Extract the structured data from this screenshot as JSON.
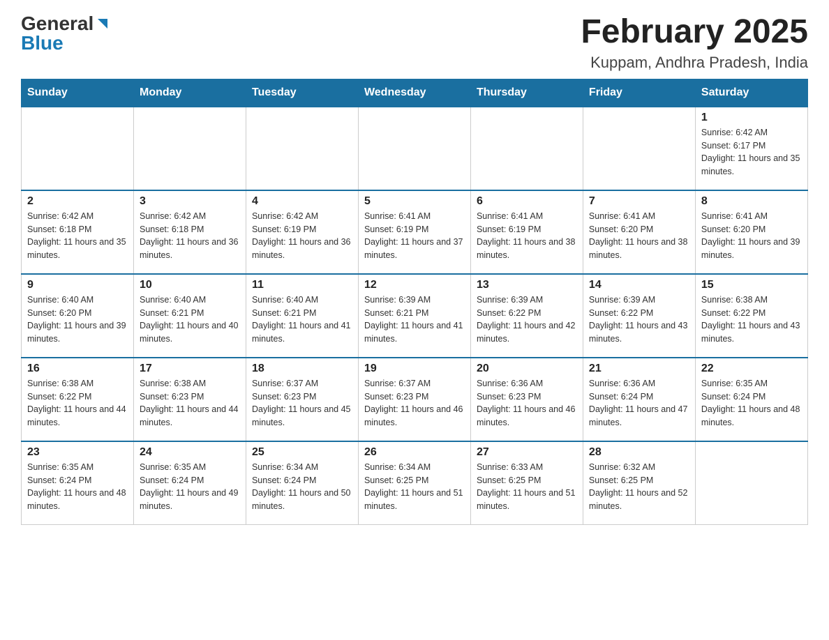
{
  "header": {
    "logo_general": "General",
    "logo_blue": "Blue",
    "month_title": "February 2025",
    "location": "Kuppam, Andhra Pradesh, India"
  },
  "weekdays": [
    "Sunday",
    "Monday",
    "Tuesday",
    "Wednesday",
    "Thursday",
    "Friday",
    "Saturday"
  ],
  "weeks": [
    [
      {
        "day": "",
        "info": ""
      },
      {
        "day": "",
        "info": ""
      },
      {
        "day": "",
        "info": ""
      },
      {
        "day": "",
        "info": ""
      },
      {
        "day": "",
        "info": ""
      },
      {
        "day": "",
        "info": ""
      },
      {
        "day": "1",
        "info": "Sunrise: 6:42 AM\nSunset: 6:17 PM\nDaylight: 11 hours and 35 minutes."
      }
    ],
    [
      {
        "day": "2",
        "info": "Sunrise: 6:42 AM\nSunset: 6:18 PM\nDaylight: 11 hours and 35 minutes."
      },
      {
        "day": "3",
        "info": "Sunrise: 6:42 AM\nSunset: 6:18 PM\nDaylight: 11 hours and 36 minutes."
      },
      {
        "day": "4",
        "info": "Sunrise: 6:42 AM\nSunset: 6:19 PM\nDaylight: 11 hours and 36 minutes."
      },
      {
        "day": "5",
        "info": "Sunrise: 6:41 AM\nSunset: 6:19 PM\nDaylight: 11 hours and 37 minutes."
      },
      {
        "day": "6",
        "info": "Sunrise: 6:41 AM\nSunset: 6:19 PM\nDaylight: 11 hours and 38 minutes."
      },
      {
        "day": "7",
        "info": "Sunrise: 6:41 AM\nSunset: 6:20 PM\nDaylight: 11 hours and 38 minutes."
      },
      {
        "day": "8",
        "info": "Sunrise: 6:41 AM\nSunset: 6:20 PM\nDaylight: 11 hours and 39 minutes."
      }
    ],
    [
      {
        "day": "9",
        "info": "Sunrise: 6:40 AM\nSunset: 6:20 PM\nDaylight: 11 hours and 39 minutes."
      },
      {
        "day": "10",
        "info": "Sunrise: 6:40 AM\nSunset: 6:21 PM\nDaylight: 11 hours and 40 minutes."
      },
      {
        "day": "11",
        "info": "Sunrise: 6:40 AM\nSunset: 6:21 PM\nDaylight: 11 hours and 41 minutes."
      },
      {
        "day": "12",
        "info": "Sunrise: 6:39 AM\nSunset: 6:21 PM\nDaylight: 11 hours and 41 minutes."
      },
      {
        "day": "13",
        "info": "Sunrise: 6:39 AM\nSunset: 6:22 PM\nDaylight: 11 hours and 42 minutes."
      },
      {
        "day": "14",
        "info": "Sunrise: 6:39 AM\nSunset: 6:22 PM\nDaylight: 11 hours and 43 minutes."
      },
      {
        "day": "15",
        "info": "Sunrise: 6:38 AM\nSunset: 6:22 PM\nDaylight: 11 hours and 43 minutes."
      }
    ],
    [
      {
        "day": "16",
        "info": "Sunrise: 6:38 AM\nSunset: 6:22 PM\nDaylight: 11 hours and 44 minutes."
      },
      {
        "day": "17",
        "info": "Sunrise: 6:38 AM\nSunset: 6:23 PM\nDaylight: 11 hours and 44 minutes."
      },
      {
        "day": "18",
        "info": "Sunrise: 6:37 AM\nSunset: 6:23 PM\nDaylight: 11 hours and 45 minutes."
      },
      {
        "day": "19",
        "info": "Sunrise: 6:37 AM\nSunset: 6:23 PM\nDaylight: 11 hours and 46 minutes."
      },
      {
        "day": "20",
        "info": "Sunrise: 6:36 AM\nSunset: 6:23 PM\nDaylight: 11 hours and 46 minutes."
      },
      {
        "day": "21",
        "info": "Sunrise: 6:36 AM\nSunset: 6:24 PM\nDaylight: 11 hours and 47 minutes."
      },
      {
        "day": "22",
        "info": "Sunrise: 6:35 AM\nSunset: 6:24 PM\nDaylight: 11 hours and 48 minutes."
      }
    ],
    [
      {
        "day": "23",
        "info": "Sunrise: 6:35 AM\nSunset: 6:24 PM\nDaylight: 11 hours and 48 minutes."
      },
      {
        "day": "24",
        "info": "Sunrise: 6:35 AM\nSunset: 6:24 PM\nDaylight: 11 hours and 49 minutes."
      },
      {
        "day": "25",
        "info": "Sunrise: 6:34 AM\nSunset: 6:24 PM\nDaylight: 11 hours and 50 minutes."
      },
      {
        "day": "26",
        "info": "Sunrise: 6:34 AM\nSunset: 6:25 PM\nDaylight: 11 hours and 51 minutes."
      },
      {
        "day": "27",
        "info": "Sunrise: 6:33 AM\nSunset: 6:25 PM\nDaylight: 11 hours and 51 minutes."
      },
      {
        "day": "28",
        "info": "Sunrise: 6:32 AM\nSunset: 6:25 PM\nDaylight: 11 hours and 52 minutes."
      },
      {
        "day": "",
        "info": ""
      }
    ]
  ]
}
